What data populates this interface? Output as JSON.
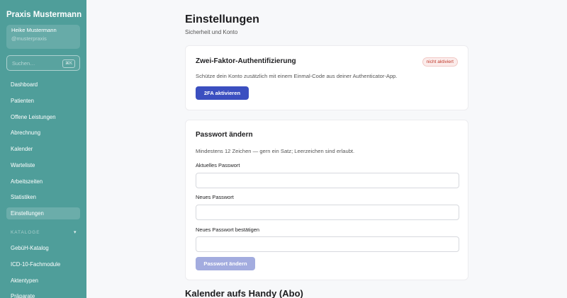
{
  "sidebar": {
    "brand": "Praxis Mustermann",
    "user": {
      "name": "Heike Mustermann",
      "handle": "@musterpraxis"
    },
    "search": {
      "placeholder": "Suchen…",
      "shortcut": "⌘K"
    },
    "items": [
      {
        "label": "Dashboard"
      },
      {
        "label": "Patienten"
      },
      {
        "label": "Offene Leistungen"
      },
      {
        "label": "Abrechnung"
      },
      {
        "label": "Kalender"
      },
      {
        "label": "Warteliste"
      },
      {
        "label": "Arbeitszeiten"
      },
      {
        "label": "Statistiken"
      },
      {
        "label": "Einstellungen",
        "active": true
      }
    ],
    "section": {
      "label": "KATALOGE",
      "caret": "▾"
    },
    "catalog_items": [
      {
        "label": "GebüH-Katalog"
      },
      {
        "label": "ICD-10-Fachmodule"
      },
      {
        "label": "Aktentypen"
      },
      {
        "label": "Präparate"
      }
    ],
    "colors": {
      "background": "#4f9e9a"
    }
  },
  "main": {
    "title": "Einstellungen",
    "subtitle": "Sicherheit und Konto",
    "two_factor": {
      "title": "Zwei-Faktor-Authentifizierung",
      "status": "nicht aktiviert",
      "description": "Schütze dein Konto zusätzlich mit einem Einmal-Code aus deiner Authenticator-App.",
      "button": "2FA aktivieren"
    },
    "password": {
      "title": "Passwort ändern",
      "hint": "Mindestens 12 Zeichen — gern ein Satz; Leerzeichen sind erlaubt.",
      "current_label": "Aktuelles Passwort",
      "new_label": "Neues Passwort",
      "confirm_label": "Neues Passwort bestätigen",
      "current_value": "",
      "new_value": "",
      "confirm_value": "",
      "button": "Passwort ändern"
    },
    "next_section_title": "Kalender aufs Handy (Abo)",
    "colors": {
      "primary": "#3b4fc0",
      "primary_disabled": "#a3acdf",
      "danger": "#c0392b"
    }
  }
}
